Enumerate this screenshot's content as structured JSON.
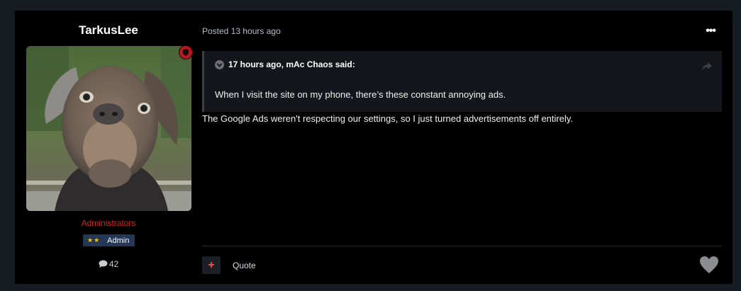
{
  "author": {
    "username": "TarkusLee",
    "group": "Administrators",
    "rank_stars": "★★",
    "rank_label": "Admin",
    "post_count": "42"
  },
  "post": {
    "posted": "Posted 13 hours ago",
    "quote": {
      "citation": "17 hours ago, mAc Chaos said:",
      "text": "When I visit the site on my phone, there’s these constant annoying ads."
    },
    "body": "The Google Ads weren't respecting our settings, so I just turned advertisements off entirely.",
    "quote_label": "Quote",
    "more_label": "•••",
    "multiquote_label": "+"
  },
  "colors": {
    "page_bg": "#161a21",
    "post_bg": "#000000",
    "group": "#e11b1b",
    "rank_bg": "#243754",
    "badge": "#b3191f"
  },
  "icons": {
    "avatar": "dog-photo-avatar",
    "moderator_badge": "shield-icon",
    "post_count": "comment-bubble-icon",
    "quote_toggle": "chevron-down-icon",
    "quote_share": "share-arrow-icon",
    "react": "heart-icon"
  }
}
